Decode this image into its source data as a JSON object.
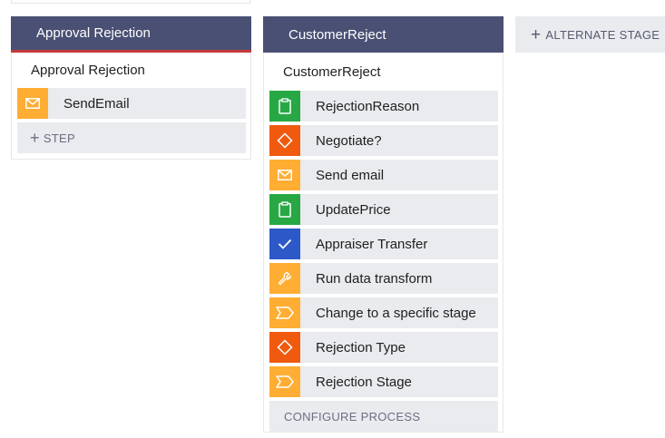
{
  "stages": [
    {
      "name": "Approval Rejection",
      "process": "Approval Rejection",
      "steps": [
        {
          "label": "SendEmail",
          "icon": "envelope-icon",
          "color": "#ffad33"
        }
      ],
      "add_step_label": "STEP"
    },
    {
      "name": "CustomerReject",
      "process": "CustomerReject",
      "steps": [
        {
          "label": "RejectionReason",
          "icon": "clipboard-icon",
          "color": "#27a844"
        },
        {
          "label": "Negotiate?",
          "icon": "decision-diamond-icon",
          "color": "#f05a0e"
        },
        {
          "label": "Send email",
          "icon": "envelope-icon",
          "color": "#ffad33"
        },
        {
          "label": "UpdatePrice",
          "icon": "clipboard-icon",
          "color": "#27a844"
        },
        {
          "label": "Appraiser Transfer",
          "icon": "checkmark-icon",
          "color": "#2d59c8"
        },
        {
          "label": "Run data transform",
          "icon": "wrench-icon",
          "color": "#ffad33"
        },
        {
          "label": "Change to a specific stage",
          "icon": "chevron-stage-icon",
          "color": "#ffad33"
        },
        {
          "label": "Rejection Type",
          "icon": "decision-diamond-icon",
          "color": "#f05a0e"
        },
        {
          "label": "Rejection Stage",
          "icon": "chevron-stage-icon",
          "color": "#ffad33"
        }
      ],
      "configure_label": "CONFIGURE PROCESS"
    }
  ],
  "alternate_stage_label": "ALTERNATE STAGE",
  "colors": {
    "stage_header": "#4a5073",
    "stage_accent": "#c23a3a",
    "row_bg": "#e9ebef"
  }
}
